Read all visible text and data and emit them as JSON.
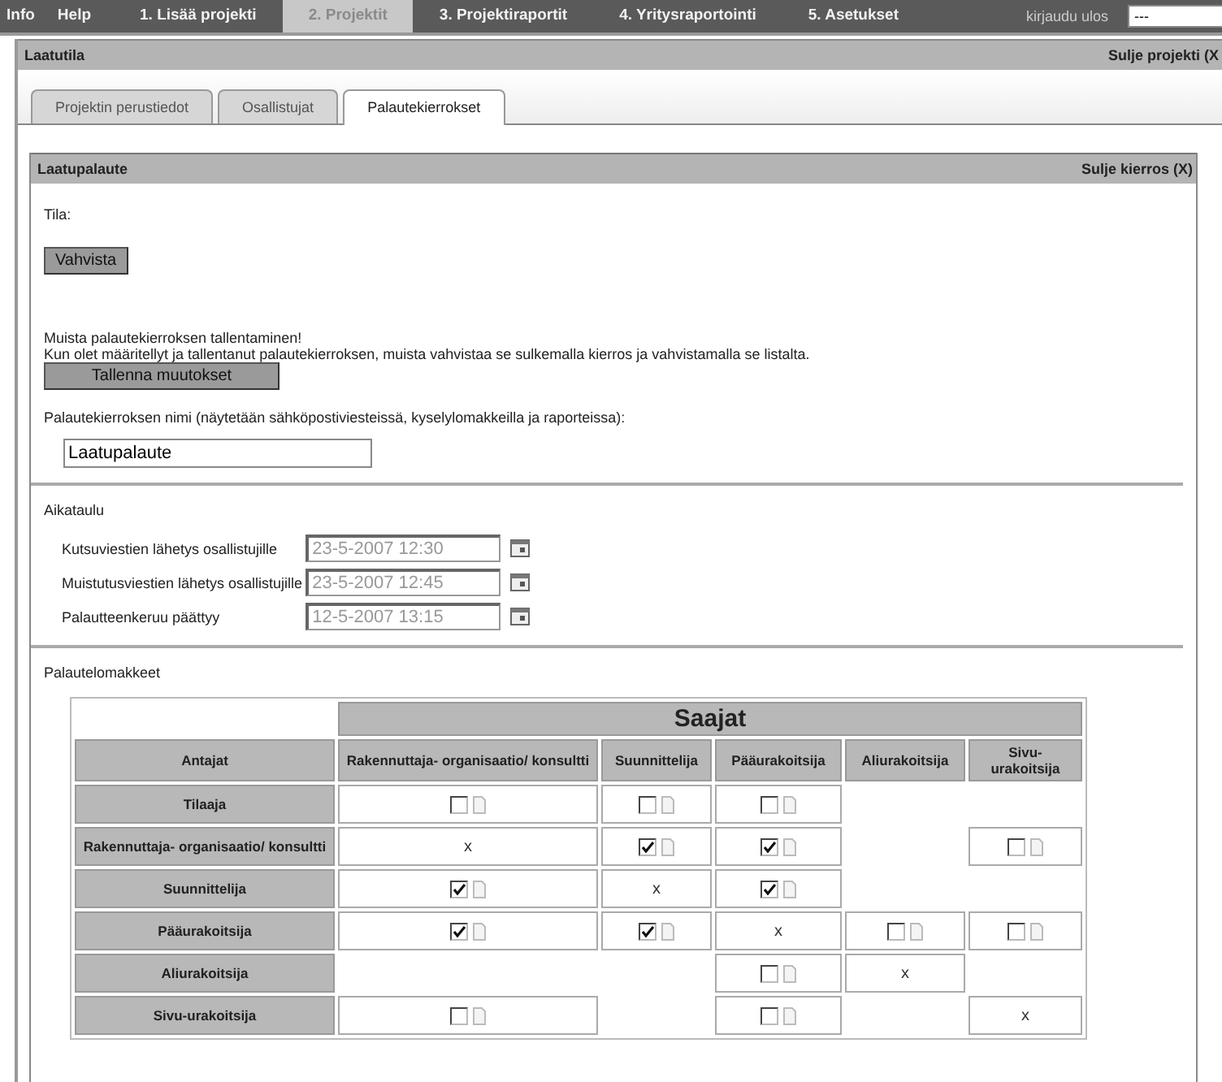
{
  "nav": {
    "items": [
      {
        "label": "Info",
        "selected": false
      },
      {
        "label": "Help",
        "selected": false
      },
      {
        "label": "1. Lisää projekti",
        "selected": false
      },
      {
        "label": "2. Projektit",
        "selected": true
      },
      {
        "label": "3. Projektiraportit",
        "selected": false
      },
      {
        "label": "4. Yritysraportointi",
        "selected": false
      },
      {
        "label": "5. Asetukset",
        "selected": false
      }
    ],
    "logout": "kirjaudu ulos",
    "search_value": "---"
  },
  "project": {
    "title": "Laatutila",
    "close": "Sulje projekti (X"
  },
  "tabs": [
    {
      "label": "Projektin perustiedot",
      "selected": false
    },
    {
      "label": "Osallistujat",
      "selected": false
    },
    {
      "label": "Palautekierrokset",
      "selected": true
    }
  ],
  "round": {
    "title": "Laatupalaute",
    "close": "Sulje kierros (X)",
    "status_label": "Tila:",
    "confirm_button": "Vahvista",
    "reminder_title": "Muista palautekierroksen tallentaminen!",
    "reminder_text": "Kun olet määritellyt ja tallentanut palautekierroksen, muista vahvistaa se sulkemalla kierros ja vahvistamalla se listalta.",
    "save_button": "Tallenna muutokset",
    "name_label": "Palautekierroksen nimi (näytetään sähköpostiviesteissä, kyselylomakkeilla ja raporteissa):",
    "name_value": "Laatupalaute"
  },
  "schedule": {
    "title": "Aikataulu",
    "rows": [
      {
        "label": "Kutsuviestien lähetys osallistujille",
        "value": "23-5-2007 12:30",
        "disabled": true
      },
      {
        "label": "Muistutusviestien lähetys osallistujille",
        "value": "23-5-2007 12:45",
        "disabled": true
      },
      {
        "label": "Palautteenkeruu päättyy",
        "value": "12-5-2007 13:15",
        "disabled": true
      }
    ]
  },
  "forms": {
    "title": "Palautelomakkeet",
    "recipients_title": "Saajat",
    "givers_title": "Antajat",
    "columns": [
      "Rakennuttaja- organisaatio/ konsultti",
      "Suunnittelija",
      "Pääurakoitsija",
      "Aliurakoitsija",
      "Sivu-urakoitsija"
    ],
    "rows": [
      {
        "label": "Tilaaja",
        "cells": [
          {
            "kind": "check",
            "checked": false
          },
          {
            "kind": "check",
            "checked": false
          },
          {
            "kind": "check",
            "checked": false
          },
          {
            "kind": "empty"
          },
          {
            "kind": "empty"
          }
        ]
      },
      {
        "label": "Rakennuttaja- organisaatio/ konsultti",
        "cells": [
          {
            "kind": "self",
            "text": "x"
          },
          {
            "kind": "check",
            "checked": true
          },
          {
            "kind": "check",
            "checked": true
          },
          {
            "kind": "empty"
          },
          {
            "kind": "check",
            "checked": false
          }
        ]
      },
      {
        "label": "Suunnittelija",
        "cells": [
          {
            "kind": "check",
            "checked": true
          },
          {
            "kind": "self",
            "text": "x"
          },
          {
            "kind": "check",
            "checked": true
          },
          {
            "kind": "empty"
          },
          {
            "kind": "empty"
          }
        ]
      },
      {
        "label": "Pääurakoitsija",
        "cells": [
          {
            "kind": "check",
            "checked": true
          },
          {
            "kind": "check",
            "checked": true
          },
          {
            "kind": "self",
            "text": "x"
          },
          {
            "kind": "check",
            "checked": false
          },
          {
            "kind": "check",
            "checked": false
          }
        ]
      },
      {
        "label": "Aliurakoitsija",
        "cells": [
          {
            "kind": "empty"
          },
          {
            "kind": "empty"
          },
          {
            "kind": "check",
            "checked": false
          },
          {
            "kind": "self",
            "text": "x"
          },
          {
            "kind": "empty"
          }
        ]
      },
      {
        "label": "Sivu-urakoitsija",
        "cells": [
          {
            "kind": "check",
            "checked": false
          },
          {
            "kind": "empty"
          },
          {
            "kind": "check",
            "checked": false
          },
          {
            "kind": "empty"
          },
          {
            "kind": "self",
            "text": "x"
          }
        ]
      }
    ]
  }
}
